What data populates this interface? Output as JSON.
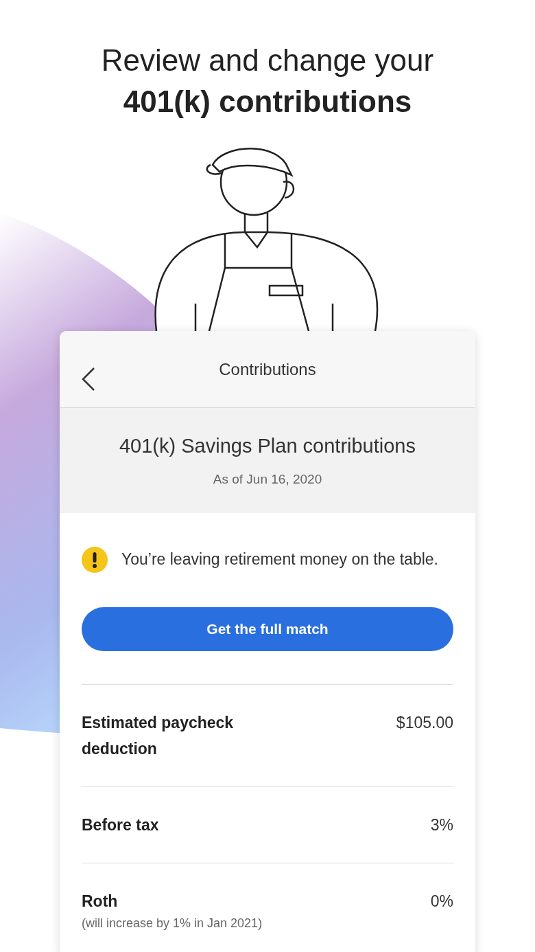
{
  "headline": {
    "line_1": "Review and change your",
    "line_2": "401(k) contributions"
  },
  "screen": {
    "title": "Contributions",
    "plan_title": "401(k) Savings Plan contributions",
    "as_of": "As of Jun 16, 2020",
    "alert": "You’re leaving retirement money on the table.",
    "button": "Get the full match",
    "rows": [
      {
        "label": "Estimated paycheck deduction",
        "value": "$105.00"
      },
      {
        "label": "Before tax",
        "value": "3%"
      },
      {
        "label": "Roth",
        "value": "0%",
        "note": "(will increase by 1% in Jan 2021)"
      }
    ]
  }
}
